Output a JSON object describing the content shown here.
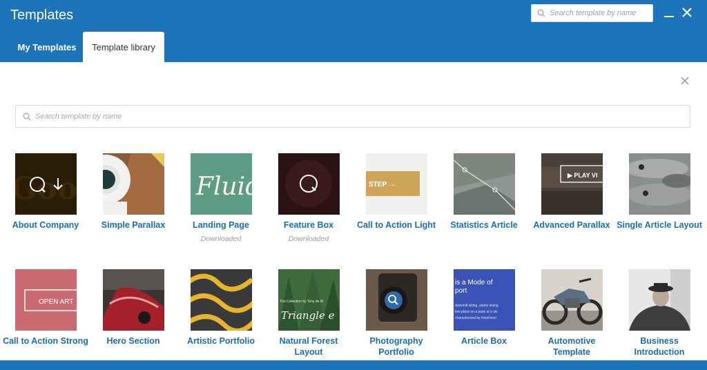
{
  "header": {
    "title": "Templates",
    "search_placeholder": "Search template by name"
  },
  "tabs": [
    {
      "label": "My Templates",
      "active": false
    },
    {
      "label": "Template library",
      "active": true
    }
  ],
  "library": {
    "search_placeholder": "Search template by name"
  },
  "templates": [
    {
      "name": "About Company",
      "status": ""
    },
    {
      "name": "Simple Parallax",
      "status": ""
    },
    {
      "name": "Landing Page",
      "status": "Downloaded"
    },
    {
      "name": "Feature Box",
      "status": "Downloaded"
    },
    {
      "name": "Call to Action Light",
      "status": ""
    },
    {
      "name": "Statistics Article",
      "status": ""
    },
    {
      "name": "Advanced Parallax",
      "status": ""
    },
    {
      "name": "Single Article Layout",
      "status": ""
    },
    {
      "name": "Call to Action Strong",
      "status": ""
    },
    {
      "name": "Hero Section",
      "status": ""
    },
    {
      "name": "Artistic Portfolio",
      "status": ""
    },
    {
      "name": "Natural Forest Layout",
      "status": ""
    },
    {
      "name": "Photography Portfolio",
      "status": ""
    },
    {
      "name": "Article Box",
      "status": ""
    },
    {
      "name": "Automotive Template",
      "status": ""
    },
    {
      "name": "Business Introduction",
      "status": ""
    }
  ],
  "thumb_text": {
    "landing": "Fluid",
    "cta_light": "STEP →",
    "adv_parallax": "▶ PLAY VI",
    "cta_strong": "OPEN ART",
    "forest_small": "The Collection by Tony de M",
    "forest_script": "Triangle e",
    "article_box_title": "is a Mode of",
    "article_box_title2": "port",
    "article_box_body1": "downhill skiing, alpine skiing",
    "article_box_body2": "kes place on a piste at a ski",
    "article_box_body3": "characterized by fixed-heel"
  },
  "colors": {
    "brand": "#1e74b8",
    "label": "#1b6ea8"
  }
}
